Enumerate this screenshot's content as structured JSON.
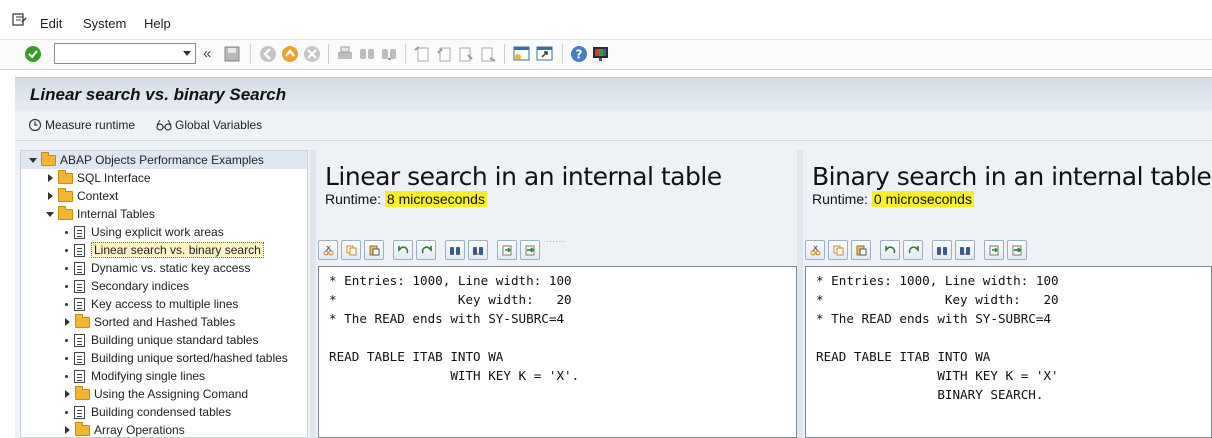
{
  "menu": {
    "items": [
      "Edit",
      "System",
      "Help"
    ]
  },
  "toolbar": {
    "command_field_value": "",
    "icons": [
      "enter-icon",
      "back-icon",
      "save-icon",
      "back-nav-icon",
      "exit-icon",
      "cancel-icon",
      "print-icon",
      "find-icon",
      "find-next-icon",
      "first-page-icon",
      "previous-page-icon",
      "next-page-icon",
      "last-page-icon",
      "create-session-icon",
      "shortcut-icon",
      "help-icon",
      "customize-layout-icon"
    ]
  },
  "title": "Linear search vs. binary Search",
  "app_toolbar": {
    "measure_runtime": "Measure runtime",
    "global_variables": "Global Variables"
  },
  "tree": {
    "items": [
      {
        "label": "ABAP Objects Performance Examples",
        "type": "folder",
        "level": 0,
        "expanded": true
      },
      {
        "label": "SQL Interface",
        "type": "folder",
        "level": 1,
        "expanded": false
      },
      {
        "label": "Context",
        "type": "folder",
        "level": 1,
        "expanded": false
      },
      {
        "label": "Internal Tables",
        "type": "folder",
        "level": 1,
        "expanded": true
      },
      {
        "label": "Using explicit work areas",
        "type": "doc",
        "level": 2
      },
      {
        "label": "Linear search vs. binary search",
        "type": "doc",
        "level": 2,
        "selected": true
      },
      {
        "label": "Dynamic vs. static key access",
        "type": "doc",
        "level": 2
      },
      {
        "label": "Secondary indices",
        "type": "doc",
        "level": 2
      },
      {
        "label": "Key access to multiple lines",
        "type": "doc",
        "level": 2
      },
      {
        "label": "Sorted and Hashed Tables",
        "type": "folder",
        "level": 2,
        "expanded": false
      },
      {
        "label": "Building unique standard tables",
        "type": "doc",
        "level": 2
      },
      {
        "label": "Building unique sorted/hashed tables",
        "type": "doc",
        "level": 2
      },
      {
        "label": "Modifying single lines",
        "type": "doc",
        "level": 2
      },
      {
        "label": "Using the Assigning Comand",
        "type": "folder",
        "level": 2,
        "expanded": false
      },
      {
        "label": "Building condensed tables",
        "type": "doc",
        "level": 2
      },
      {
        "label": "Array Operations",
        "type": "folder",
        "level": 2,
        "expanded": false
      }
    ]
  },
  "left_panel": {
    "heading": "Linear search in an internal table",
    "runtime_label": "Runtime:",
    "runtime_value": "8 microseconds",
    "code": "* Entries: 1000, Line width: 100\n*                Key width:   20\n* The READ ends with SY-SUBRC=4\n\nREAD TABLE ITAB INTO WA\n                WITH KEY K = 'X'."
  },
  "right_panel": {
    "heading": "Binary search in an internal table",
    "runtime_label": "Runtime:",
    "runtime_value": "0 microseconds",
    "code": "* Entries: 1000, Line width: 100\n*                Key width:   20\n* The READ ends with SY-SUBRC=4\n\nREAD TABLE ITAB INTO WA\n                WITH KEY K = 'X'\n                BINARY SEARCH."
  },
  "editor_toolbar_icons": [
    "cut-icon",
    "copy-icon",
    "paste-icon",
    "undo-icon",
    "redo-icon",
    "find-icon",
    "find-next-icon",
    "load-local-file-icon",
    "download-icon"
  ],
  "colors": {
    "highlight": "#f6ef2a",
    "title_bar": "#d5dce6",
    "selection_border": "#d0531f"
  }
}
